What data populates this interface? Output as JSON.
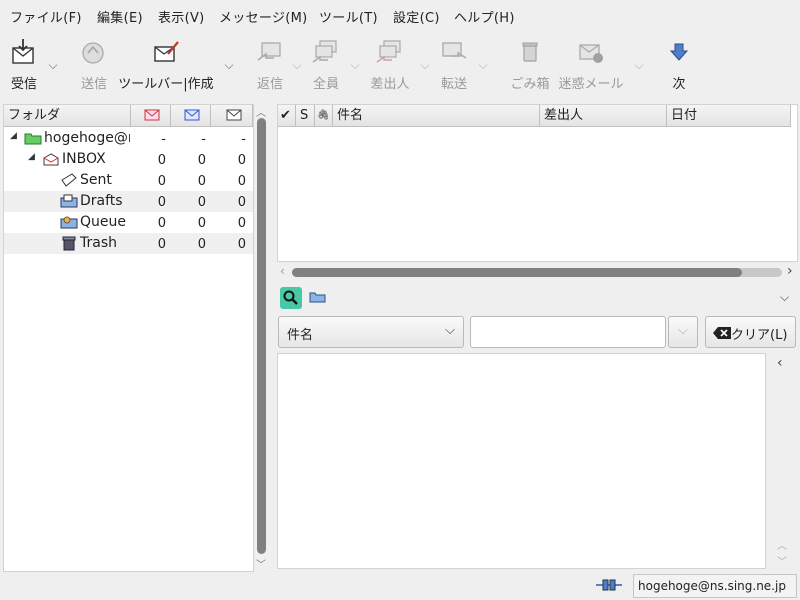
{
  "menubar": {
    "items": [
      "ファイル(F)",
      "編集(E)",
      "表示(V)",
      "メッセージ(M)",
      "ツール(T)",
      "設定(C)",
      "ヘルプ(H)"
    ]
  },
  "toolbar": {
    "receive": "受信",
    "send": "送信",
    "compose": "ツールバー|作成",
    "reply": "返信",
    "reply_all": "全員",
    "reply_sender": "差出人",
    "forward": "転送",
    "trash": "ごみ箱",
    "junk": "迷惑メール",
    "next": "次"
  },
  "folder_pane": {
    "header": "フォルダ",
    "folders": [
      {
        "name": "hogehoge@ns.sing.ne.jp",
        "new": "-",
        "unread": "-",
        "total": "-"
      },
      {
        "name": "INBOX",
        "new": "0",
        "unread": "0",
        "total": "0"
      },
      {
        "name": "Sent",
        "new": "0",
        "unread": "0",
        "total": "0"
      },
      {
        "name": "Drafts",
        "new": "0",
        "unread": "0",
        "total": "0"
      },
      {
        "name": "Queue",
        "new": "0",
        "unread": "0",
        "total": "0"
      },
      {
        "name": "Trash",
        "new": "0",
        "unread": "0",
        "total": "0"
      }
    ]
  },
  "message_list": {
    "columns": [
      "✔",
      "S",
      "🖇",
      "件名",
      "差出人",
      "日付"
    ]
  },
  "search": {
    "field": "件名",
    "value": "",
    "clear_label": "クリア(L)"
  },
  "status": {
    "account": "hogehoge@ns.sing.ne.jp"
  },
  "colors": {
    "search_button": "#47c9a8",
    "scroll_thumb": "#808080"
  }
}
